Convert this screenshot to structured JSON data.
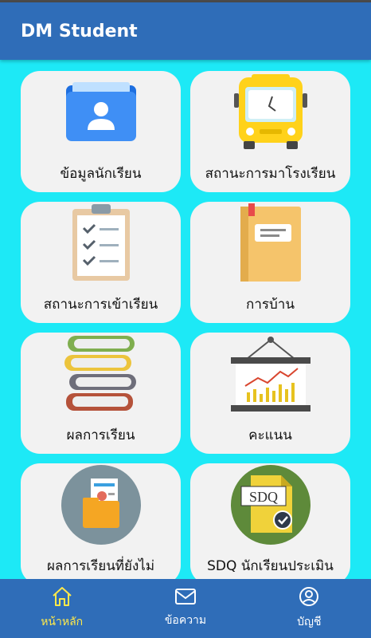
{
  "appbar": {
    "title": "DM Student"
  },
  "menu": [
    {
      "label": "ข้อมูลนักเรียน",
      "icon": "student-folder-icon"
    },
    {
      "label": "สถานะการมาโรงเรียน",
      "icon": "school-bus-icon"
    },
    {
      "label": "สถานะการเข้าเรียน",
      "icon": "checklist-clipboard-icon"
    },
    {
      "label": "การบ้าน",
      "icon": "notebook-icon"
    },
    {
      "label": "ผลการเรียน",
      "icon": "book-stack-icon"
    },
    {
      "label": "คะแนน",
      "icon": "chart-board-icon"
    },
    {
      "label": "ผลการเรียนที่ยังไม่",
      "icon": "report-folder-icon"
    },
    {
      "label": "SDQ นักเรียนประเมิน",
      "icon": "sdq-document-icon",
      "badge_text": "SDQ"
    }
  ],
  "bottom_nav": [
    {
      "label": "หน้าหลัก",
      "icon": "home-icon",
      "active": true
    },
    {
      "label": "ข้อความ",
      "icon": "mail-icon",
      "active": false
    },
    {
      "label": "บัญชี",
      "icon": "account-icon",
      "active": false
    }
  ],
  "colors": {
    "background": "#1de9f6",
    "primary": "#2f6db8",
    "active_nav": "#ffe94a",
    "card": "#f2f2f2"
  }
}
